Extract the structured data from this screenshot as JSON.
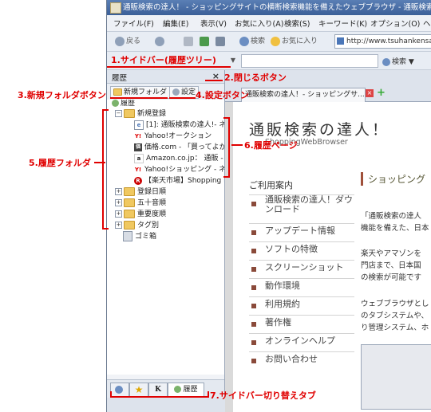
{
  "window": {
    "title": "通販検索の達人！ - ショッピングサイトの横断検索機能を備えたウェブブラウザ - 通販検索の達人！",
    "menu": [
      "ファイル(F)",
      "編集(E)",
      "表示(V)",
      "お気に入り(A)",
      "検索(S)",
      "キーワード(K)",
      "オプション(O)",
      "ヘ"
    ],
    "nav": {
      "back": "戻る",
      "search": "検索",
      "favorites": "お気に入り",
      "url": "http://www.tsuhankensaku"
    },
    "search_button": "検索"
  },
  "sidebar": {
    "header": "履歴",
    "close_glyph": "×",
    "new_folder": "新規フォルダ",
    "settings": "設定",
    "tree": {
      "root": "履歴",
      "folders": [
        {
          "label": "新規登録",
          "expanded": true,
          "pages": [
            {
              "icon": "page-icon",
              "label": "[1]: 通販検索の達人!- ネ"
            },
            {
              "icon": "yahoo-icon",
              "label": "Yahoo!オークション"
            },
            {
              "icon": "kakaku-icon",
              "label": "価格.com - 「買ってよか"
            },
            {
              "icon": "amazon-icon",
              "label": "Amazon.co.jp： 通販 -"
            },
            {
              "icon": "yahoo-icon",
              "label": "Yahoo!ショッピング - ネ"
            },
            {
              "icon": "rakuten-icon",
              "label": "【楽天市場】Shopping i"
            }
          ]
        },
        {
          "label": "登録日順",
          "expanded": false
        },
        {
          "label": "五十音順",
          "expanded": false
        },
        {
          "label": "重要度順",
          "expanded": false
        },
        {
          "label": "タグ別",
          "expanded": false
        }
      ],
      "trash": "ゴミ箱"
    },
    "tabs": [
      "検索",
      "お気に入り",
      "K",
      "履歴"
    ]
  },
  "browser_tab": {
    "title": "通販検索の達人！- ショッピングサ..."
  },
  "page": {
    "title": "通販検索の達人！",
    "subtitle": "ShoppingWebBrowser",
    "nav_heading": "ご利用案内",
    "nav_items": [
      "通販検索の達人！ダウンロード",
      "アップデート情報",
      "ソフトの特徴",
      "スクリーンショット",
      "動作環境",
      "利用規約",
      "著作権",
      "オンラインヘルプ",
      "お問い合わせ"
    ],
    "right_heading": "ショッピング",
    "right_text": [
      "「通販検索の達人",
      "機能を備えた、日本",
      "楽天やアマゾンを",
      "門店まで、日本国",
      "の検索が可能です",
      "ウェブブラウザとし",
      "のタブシステムや、",
      "り管理システム、ホ"
    ]
  },
  "annotations": {
    "a1": "1.サイドバー(履歴ツリー)",
    "a2": "2.閉じるボタン",
    "a3": "3.新規フォルダボタン",
    "a4": "4.設定ボタン",
    "a5": "5.履歴フォルダ",
    "a6": "6.履歴ページ",
    "a7": "7.サイドバー切り替えタブ"
  },
  "colors": {
    "annotation": "#e00000",
    "title_bar": "#3b5f98",
    "nav_marker": "#8a4a3a"
  }
}
